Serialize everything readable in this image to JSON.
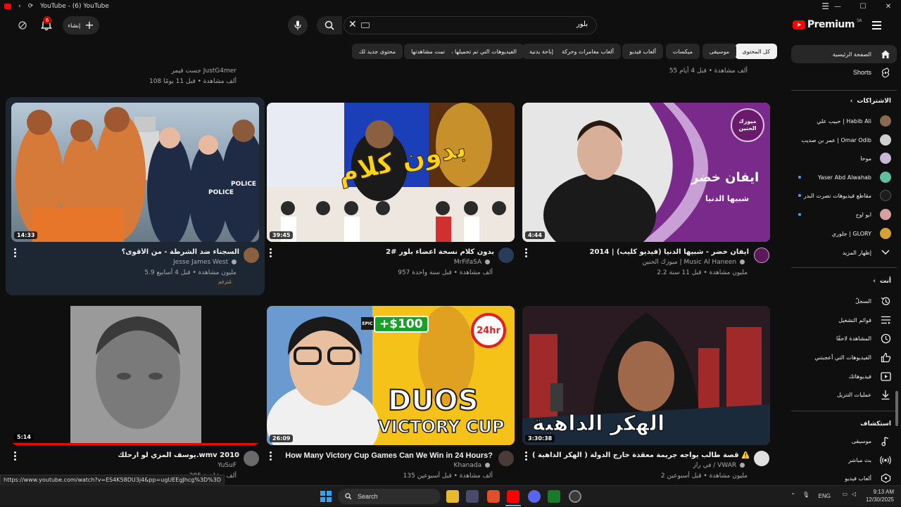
{
  "window": {
    "title": "YouTube - (6) YouTube",
    "controls": [
      "—",
      "☐",
      "✕"
    ]
  },
  "masthead": {
    "create_label": "إنشاء",
    "notification_count": "6",
    "search_query": "بلور",
    "logo_text": "Premium",
    "logo_region": "SA"
  },
  "chips": [
    {
      "label": "كل المحتوى",
      "active": true
    },
    {
      "label": "موسيقى"
    },
    {
      "label": "ميكسات"
    },
    {
      "label": "ألعاب فيديو"
    },
    {
      "label": "ألعاب مغامرات وحركة"
    },
    {
      "label": "إباحة بدنية"
    },
    {
      "label": "الفيديوهات التي تم تحميلها مؤخرًا"
    },
    {
      "label": "تمت مشاهدتها"
    },
    {
      "label": "محتوى جديد لك"
    }
  ],
  "sidebar": {
    "home": "الصفحة الرئيسية",
    "shorts": "Shorts",
    "subscriptions_header": "الاشتراكات",
    "subscriptions": [
      {
        "name": "حبيب علي | Habib Ali",
        "color": "#8a6a50",
        "dot": false
      },
      {
        "name": "عمر بن صديب | Omar Odib",
        "color": "#d0d0d0",
        "dot": false
      },
      {
        "name": "موحا",
        "color": "#c9b7d6",
        "dot": false
      },
      {
        "name": "Yaser Abd Alwahab",
        "color": "#5fbf9e",
        "dot": true
      },
      {
        "name": "مقاطع فيديوهات نصرت البدر",
        "color": "#1c1c1c",
        "dot": true
      },
      {
        "name": "ابو اوح",
        "color": "#d6a0a0",
        "dot": true
      },
      {
        "name": "جلوري | GLORY",
        "color": "#d4a03a",
        "dot": false
      }
    ],
    "show_more": "إظهار المزيد",
    "you_header": "أنت",
    "you_items": [
      {
        "label": "السجلّ",
        "icon": "history-icon"
      },
      {
        "label": "قوائم التشغيل",
        "icon": "playlists-icon"
      },
      {
        "label": "المشاهدة لاحقًا",
        "icon": "watch-later-icon"
      },
      {
        "label": "الفيديوهات التي أعجبتني",
        "icon": "like-icon"
      },
      {
        "label": "فيديوهاتك",
        "icon": "your-videos-icon"
      },
      {
        "label": "عمليات التنزيل",
        "icon": "download-icon"
      }
    ],
    "explore_header": "استكشاف",
    "explore_items": [
      {
        "label": "موسيقى",
        "icon": "music-icon"
      },
      {
        "label": "بث مباشر",
        "icon": "live-icon"
      },
      {
        "label": "ألعاب فيديو",
        "icon": "gaming-icon"
      }
    ]
  },
  "top_partial": {
    "left_channel": "جست قيمر JustG4mer",
    "left_meta": "108 ألف مشاهدة • قبل 11 يومًا",
    "right_meta": "55 ألف مشاهدة • قبل 4 أيام"
  },
  "videos": [
    {
      "title": "السجناء ضد الشرطة - من الأقوى؟",
      "channel": "Jesse James West",
      "meta": "5.9 مليون مشاهدة • قبل 4 أسابيع",
      "duration": "14:33",
      "badge": "مُترجَم",
      "thumb_bg": "#8aa0b0"
    },
    {
      "title": "بدون كلام نسخة اعضاء بلور #2",
      "channel": "MrFifaSA",
      "meta": "957 ألف مشاهدة • قبل سنة واحدة",
      "duration": "39:45",
      "thumb_bg": "#1b3fb8"
    },
    {
      "title": "ايفان خضر - شبيها الدنيا (فيديو كليب) | 2014",
      "channel": "ميوزك الحنين | Music Al Haneen",
      "meta": "2.2 مليون مشاهدة • قبل 11 سنة",
      "duration": "4:44",
      "thumb_bg": "#7a2a8a"
    },
    {
      "title": "يوسف المزي لو ارحلك.wmv 2010",
      "channel": "YuSuF",
      "meta": "285 ألف مشاهدة",
      "duration": "5:14",
      "thumb_bg": "#9a9a9a"
    },
    {
      "title": "How Many Victory Cup Games Can We Win in 24 Hours?",
      "channel": "Khanada",
      "meta": "135 ألف مشاهدة • قبل أسبوعين",
      "duration": "26:09",
      "thumb_bg": "#f5c21a"
    },
    {
      "title": "قصة طالب يواجه جريمة معقدة خارج الدولة ( الهكر الداهية ) ⚠️💻",
      "channel": "في راز / VWAR",
      "meta": "2 مليون مشاهدة • قبل أسبوعين",
      "duration": "3:30:38",
      "thumb_bg": "#1a1a1a"
    }
  ],
  "thumb_text": {
    "v2_big": "بدون كلام",
    "v3_name": "ايفان خضر",
    "v3_song": "شبيها الدنيا",
    "v3_logo": "ميوزك الحنين",
    "v5_price": "+$100",
    "v5_time": "24hr",
    "v5_duos": "DUOS",
    "v5_cup": "VICTORY CUP",
    "v5_epic": "EPIC",
    "v6_title": "الهكر الداهية"
  },
  "status_url": "https://www.youtube.com/watch?v=ES4K58DU3j4&pp=ugUEEgJhcg%3D%3D",
  "taskbar": {
    "search": "Search",
    "lang": "ENG",
    "time": "9:13 AM",
    "date": "12/30/2025"
  },
  "colors": {
    "accent_red": "#ff0000",
    "background": "#0f0f0f",
    "hover_card": "#1d2633"
  }
}
